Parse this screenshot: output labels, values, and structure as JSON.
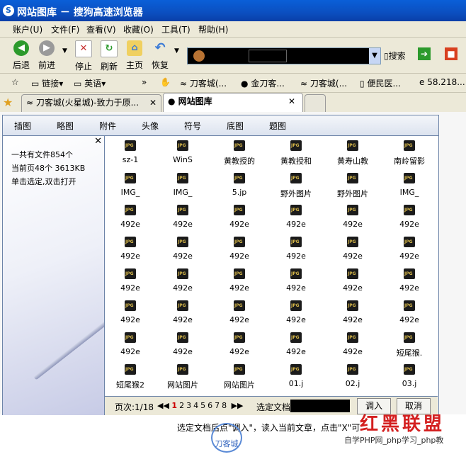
{
  "window": {
    "title": "网站图库 － 搜狗高速浏览器"
  },
  "menu": [
    {
      "label": "账户(U)"
    },
    {
      "label": "文件(F)"
    },
    {
      "label": "查看(V)"
    },
    {
      "label": "收藏(O)"
    },
    {
      "label": "工具(T)"
    },
    {
      "label": "帮助(H)"
    }
  ],
  "toolbar": {
    "back": "后退",
    "forward": "前进",
    "stop": "停止",
    "refresh": "刷新",
    "home": "主页",
    "restore": "恢复",
    "sogou_label": "搜索",
    "colors": {
      "back": "#2c9a2c",
      "forward": "#8a8a8a",
      "stop": "#c83232",
      "refresh": "#2c9a2c",
      "home": "#3a7ad6",
      "restore": "#3a7ad6"
    }
  },
  "links": {
    "links_label": "链接",
    "english_label": "英语",
    "items": [
      "刀客城(...",
      "金刀客...",
      "刀客城(...",
      "便民医...",
      "58.218..."
    ]
  },
  "tabs": [
    {
      "label": "刀客城(火星城)-致力于原..."
    },
    {
      "label": "网站图库"
    }
  ],
  "gallery": {
    "category_tabs": [
      "插图",
      "略图",
      "附件",
      "头像",
      "符号",
      "底图",
      "题图"
    ],
    "info": {
      "total": "一共有文件854个",
      "page": "当前页48个 3613KB",
      "hint": "单击选定,双击打开"
    },
    "files": [
      [
        "sz-1",
        "WinS",
        "黄教授的",
        "黄教授和",
        "黄寿山教",
        "南岭留影"
      ],
      [
        "IMG_",
        "IMG_",
        "5.jp",
        "野外图片",
        "野外图片",
        "IMG_"
      ],
      [
        "492e",
        "492e",
        "492e",
        "492e",
        "492e",
        "492e"
      ],
      [
        "492e",
        "492e",
        "492e",
        "492e",
        "492e",
        "492e"
      ],
      [
        "492e",
        "492e",
        "492e",
        "492e",
        "492e",
        "492e"
      ],
      [
        "492e",
        "492e",
        "492e",
        "492e",
        "492e",
        "492e"
      ],
      [
        "492e",
        "492e",
        "492e",
        "492e",
        "492e",
        "短尾猴."
      ],
      [
        "短尾猴2",
        "网站图片",
        "网站图片",
        "01.j",
        "02.j",
        "03.j"
      ]
    ],
    "pager": {
      "label": "页次:1/18",
      "first": "◀◀",
      "pages": [
        "1",
        "2",
        "3",
        "4",
        "5",
        "6",
        "7",
        "8"
      ],
      "last": "▶▶",
      "current": "1"
    },
    "select_label": "选定文档",
    "insert_button": "调入",
    "cancel_button": "取消"
  },
  "status": {
    "hint": "选定文档后点\"调入\"，读入当前文章，点击\"X\"可"
  },
  "watermark": {
    "main": "红黑联盟",
    "sub": "自学PHP网_php学习_php教",
    "logo": "刀客城"
  }
}
